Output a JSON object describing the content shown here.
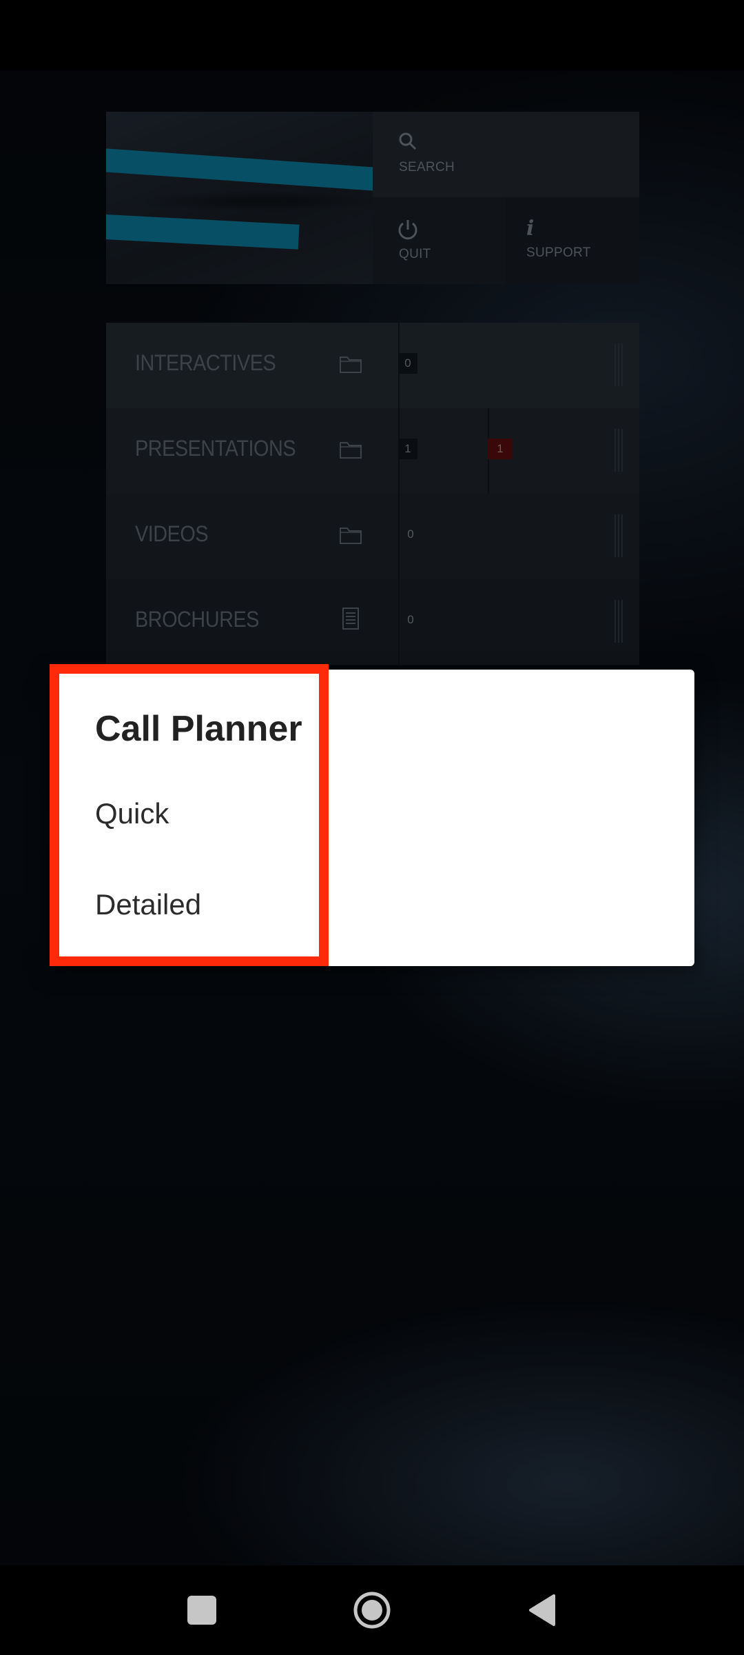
{
  "header": {
    "search_label": "SEARCH",
    "quit_label": "QUIT",
    "support_label": "SUPPORT"
  },
  "categories": [
    {
      "label": "INTERACTIVES",
      "icon": "folder-icon",
      "counts": [
        "0"
      ]
    },
    {
      "label": "PRESENTATIONS",
      "icon": "folder-icon",
      "counts": [
        "1",
        "1"
      ]
    },
    {
      "label": "VIDEOS",
      "icon": "folder-icon",
      "counts": [
        "0"
      ]
    },
    {
      "label": "BROCHURES",
      "icon": "document-icon",
      "counts": [
        "0"
      ]
    }
  ],
  "dialog": {
    "title": "Call Planner",
    "items": [
      "Quick",
      "Detailed"
    ]
  },
  "colors": {
    "accent_stripe": "#0e90b8",
    "highlight_border": "#ff2a0a",
    "alert_badge": "#6b0f12"
  },
  "navbar": {
    "icons": [
      "recent-apps-icon",
      "home-icon",
      "back-icon"
    ]
  }
}
